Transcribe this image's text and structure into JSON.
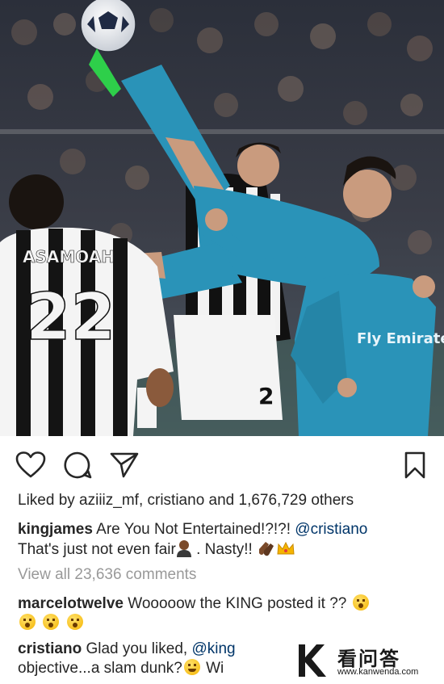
{
  "post": {
    "image_alt": "",
    "jersey_back_name": "ASAMOAH",
    "jersey_back_number": "22",
    "jersey_front_sponsor": "Fly Emirates",
    "shorts_number": "2",
    "boot_color": "#2ecf4a",
    "kit_color": "#2a93b8"
  },
  "actions": {
    "like_icon": "heart-icon",
    "comment_icon": "comment-bubble-icon",
    "share_icon": "paper-plane-icon",
    "save_icon": "bookmark-icon"
  },
  "likes": {
    "text": "Liked by aziiiz_mf, cristiano and 1,676,729 others"
  },
  "caption": {
    "username": "kingjames",
    "line1_text": " Are You Not Entertained!?!?! ",
    "mention": "@cristiano",
    "line2_text": "That's just not even fair",
    "line2_suffix": " . Nasty!! "
  },
  "view_all": "View all 23,636 comments",
  "comments": [
    {
      "username": "marcelotwelve",
      "text": " Wooooow the KING posted it ?? "
    },
    {
      "username": "cristiano",
      "text": " Glad you liked, ",
      "mention": "@king",
      "line2": "objective...a slam dunk?",
      "line2_tail": " Wi"
    }
  ],
  "watermark": {
    "title": "看问答",
    "url": "www.kanwenda.com"
  },
  "colors": {
    "text": "#262626",
    "muted": "#999999",
    "mention": "#003569",
    "accent": "#f5b400"
  }
}
